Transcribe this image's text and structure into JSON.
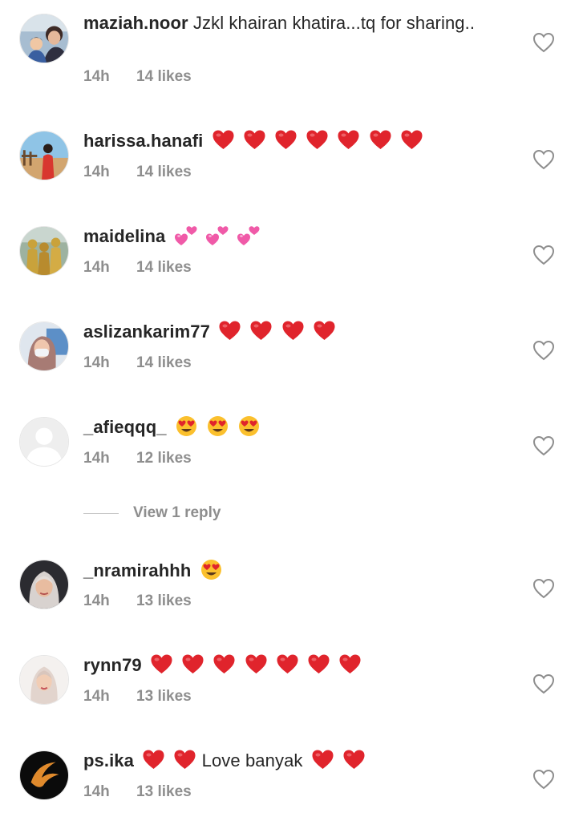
{
  "comments": [
    {
      "username": "maziah.noor",
      "text": "Jzkl khairan khatira...tq for sharing..",
      "time": "14h",
      "likes": "14 likes",
      "emojis": [],
      "trailing_text": "",
      "trailing_emojis": []
    },
    {
      "username": "harissa.hanafi",
      "text": "",
      "time": "14h",
      "likes": "14 likes",
      "emojis": [
        "red-heart",
        "red-heart",
        "red-heart",
        "red-heart",
        "red-heart",
        "red-heart",
        "red-heart"
      ],
      "trailing_text": "",
      "trailing_emojis": []
    },
    {
      "username": "maidelina",
      "text": "",
      "time": "14h",
      "likes": "14 likes",
      "emojis": [
        "revolving-hearts",
        "revolving-hearts",
        "revolving-hearts"
      ],
      "trailing_text": "",
      "trailing_emojis": []
    },
    {
      "username": "aslizankarim77",
      "text": "",
      "time": "14h",
      "likes": "14 likes",
      "emojis": [
        "red-heart",
        "red-heart",
        "red-heart",
        "red-heart"
      ],
      "trailing_text": "",
      "trailing_emojis": []
    },
    {
      "username": "_afieqqq_",
      "text": "",
      "time": "14h",
      "likes": "12 likes",
      "emojis": [
        "heart-eyes",
        "heart-eyes",
        "heart-eyes"
      ],
      "trailing_text": "",
      "trailing_emojis": []
    },
    {
      "username": "_nramirahhh",
      "text": "",
      "time": "14h",
      "likes": "13 likes",
      "emojis": [
        "heart-eyes"
      ],
      "trailing_text": "",
      "trailing_emojis": []
    },
    {
      "username": "rynn79",
      "text": "",
      "time": "14h",
      "likes": "13 likes",
      "emojis": [
        "red-heart",
        "red-heart",
        "red-heart",
        "red-heart",
        "red-heart",
        "red-heart",
        "red-heart"
      ],
      "trailing_text": "",
      "trailing_emojis": []
    },
    {
      "username": "ps.ika",
      "text": "",
      "time": "14h",
      "likes": "13 likes",
      "emojis": [
        "red-heart",
        "red-heart"
      ],
      "trailing_text": "Love banyak",
      "trailing_emojis": [
        "red-heart",
        "red-heart"
      ]
    }
  ],
  "replies": {
    "label": "View 1 reply"
  },
  "colors": {
    "primary_text": "#262626",
    "secondary_text": "#8e8e8e",
    "heart_red": "#e0242c",
    "heart_pink": "#f05aa8",
    "background": "#ffffff"
  }
}
